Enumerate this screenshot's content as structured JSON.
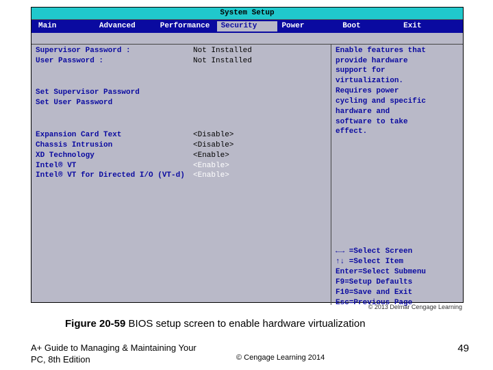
{
  "bios": {
    "title": "System Setup",
    "menu": {
      "main": "Main",
      "advanced": "Advanced",
      "performance": "Performance",
      "security": "Security",
      "power": "Power",
      "boot": "Boot",
      "exit": "Exit"
    },
    "rows": {
      "supervisor_label": "Supervisor Password :",
      "supervisor_value": "Not Installed",
      "user_label": "User Password :",
      "user_value": "Not Installed",
      "set_super": "Set Supervisor Password",
      "set_user": "Set User Password",
      "exp_label": "Expansion Card Text",
      "exp_value": "<Disable>",
      "chassis_label": "Chassis Intrusion",
      "chassis_value": "<Disable>",
      "xd_label": "XD Technology",
      "xd_value": "<Enable>",
      "vt_label": "Intel® VT",
      "vt_value": "<Enable>",
      "vtd_label": "Intel® VT for Directed I/O (VT-d)",
      "vtd_value": "<Enable>"
    },
    "help": {
      "l1": "Enable features that",
      "l2": "provide hardware",
      "l3": "support for",
      "l4": "virtualization.",
      "l5": "Requires power",
      "l6": "cycling and specific",
      "l7": "hardware and",
      "l8": "software to take",
      "l9": "effect.",
      "k1": "←→ =Select Screen",
      "k2": "↑↓ =Select Item",
      "k3": "Enter=Select Submenu",
      "k4": "F9=Setup Defaults",
      "k5": "F10=Save and Exit",
      "k6": "Esc=Previous Page"
    }
  },
  "copyright_line": "© 2013 Delmar Cengage Learning",
  "caption_prefix": "Figure 20-59",
  "caption_text": " BIOS setup screen to enable hardware virtualization",
  "book": "A+ Guide to Managing & Maintaining Your PC, 8th Edition",
  "footer_copy": "© Cengage Learning 2014",
  "page": "49"
}
